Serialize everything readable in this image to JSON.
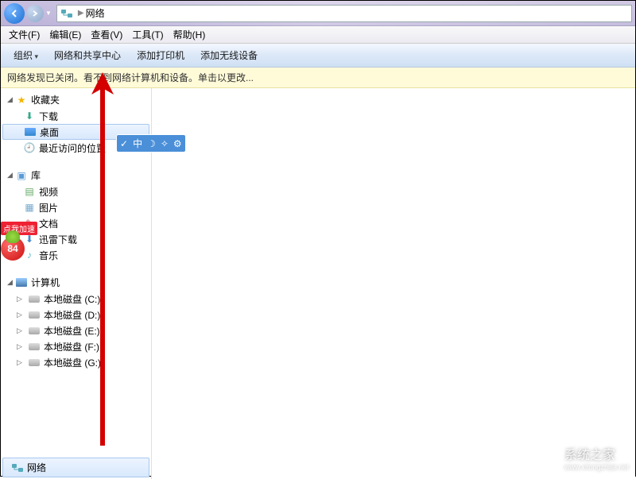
{
  "address": {
    "location": "网络"
  },
  "menu": {
    "file": "文件(F)",
    "edit": "编辑(E)",
    "view": "查看(V)",
    "tools": "工具(T)",
    "help": "帮助(H)"
  },
  "toolbar": {
    "organize": "组织",
    "netcenter": "网络和共享中心",
    "addprinter": "添加打印机",
    "addwireless": "添加无线设备"
  },
  "infobar": {
    "msg": "网络发现已关闭。看不到网络计算机和设备。单击以更改..."
  },
  "nav": {
    "fav": "收藏夹",
    "fav_items": {
      "downloads": "下载",
      "desktop": "桌面",
      "recent": "最近访问的位置"
    },
    "lib": "库",
    "lib_items": {
      "video": "视频",
      "pictures": "图片",
      "docs": "文档",
      "xunlei": "迅雷下载",
      "music": "音乐"
    },
    "comp": "计算机",
    "disks": {
      "c": "本地磁盘 (C:)",
      "d": "本地磁盘 (D:)",
      "e": "本地磁盘 (E:)",
      "f": "本地磁盘 (F:)",
      "g": "本地磁盘 (G:)"
    },
    "network": "网络"
  },
  "sidebadge": {
    "tag": "点我加速",
    "num": "84"
  },
  "widget": {
    "i1": "✓",
    "i2": "中",
    "i3": "☽",
    "i4": "✧",
    "i5": "⚙"
  },
  "watermark": {
    "text": "系统之家",
    "sub": "www.xitongzhijia.net"
  }
}
